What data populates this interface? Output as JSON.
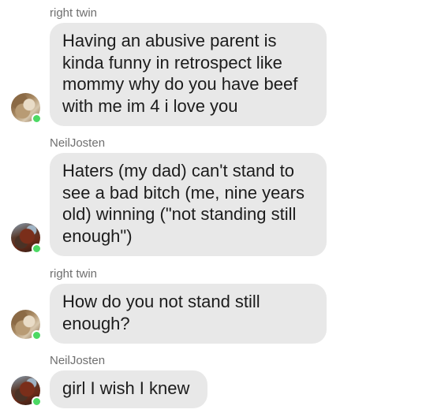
{
  "colors": {
    "bubble_background": "#e8e8e8",
    "online_status": "#4cd964",
    "sender_name": "#6f6f6f",
    "message_text": "#1c1c1c"
  },
  "messages": [
    {
      "sender": "right twin",
      "avatar": "avatar-right-twin",
      "online": true,
      "text": "Having an abusive parent is kinda funny in retrospect like mommy why do you have beef with me im 4 i love you"
    },
    {
      "sender": "NeilJosten",
      "avatar": "avatar-neiljosten",
      "online": true,
      "text": "Haters (my dad) can't stand to see a bad bitch (me, nine years old) winning (\"not standing still enough\")"
    },
    {
      "sender": "right twin",
      "avatar": "avatar-right-twin",
      "online": true,
      "text": "How do you not stand still enough?"
    },
    {
      "sender": "NeilJosten",
      "avatar": "avatar-neiljosten",
      "online": true,
      "text": "girl I wish I knew"
    }
  ]
}
